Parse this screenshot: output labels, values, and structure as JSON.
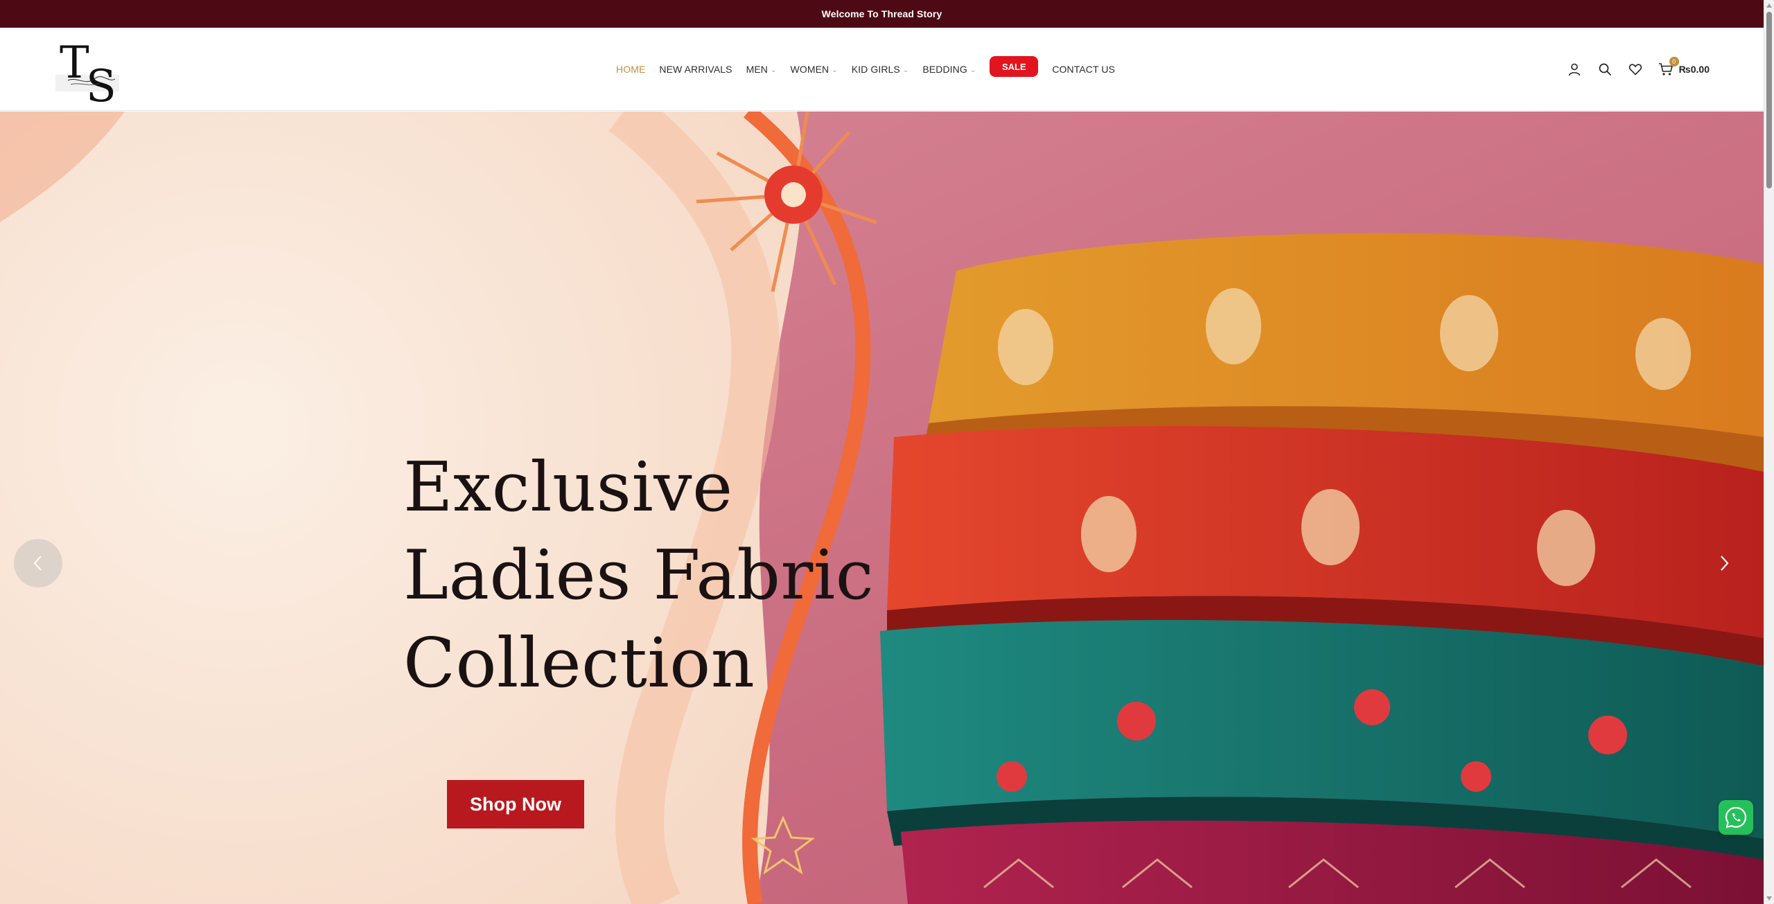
{
  "announcement": {
    "text": "Welcome To Thread Story"
  },
  "logo": {
    "letters": "TS",
    "script": "Thread Story"
  },
  "nav": {
    "home": "HOME",
    "new_arrivals": "NEW ARRIVALS",
    "men": "MEN",
    "women": "WOMEN",
    "kid_girls": "KID GIRLS",
    "bedding": "BEDDING",
    "sale": "SALE",
    "contact": "CONTACT US"
  },
  "header_tools": {
    "icons": [
      "user-icon",
      "search-icon",
      "heart-icon",
      "cart-icon"
    ],
    "cart_count": "0",
    "cart_total": "₨0.00"
  },
  "hero": {
    "title_line1": "Exclusive",
    "title_line2": "Ladies Fabric",
    "title_line3": "Collection",
    "cta": "Shop Now"
  },
  "colors": {
    "topbar": "#4e0a14",
    "accent": "#c28d3b",
    "sale": "#e2141d",
    "cta": "#b8191f",
    "whatsapp": "#26c05a"
  }
}
